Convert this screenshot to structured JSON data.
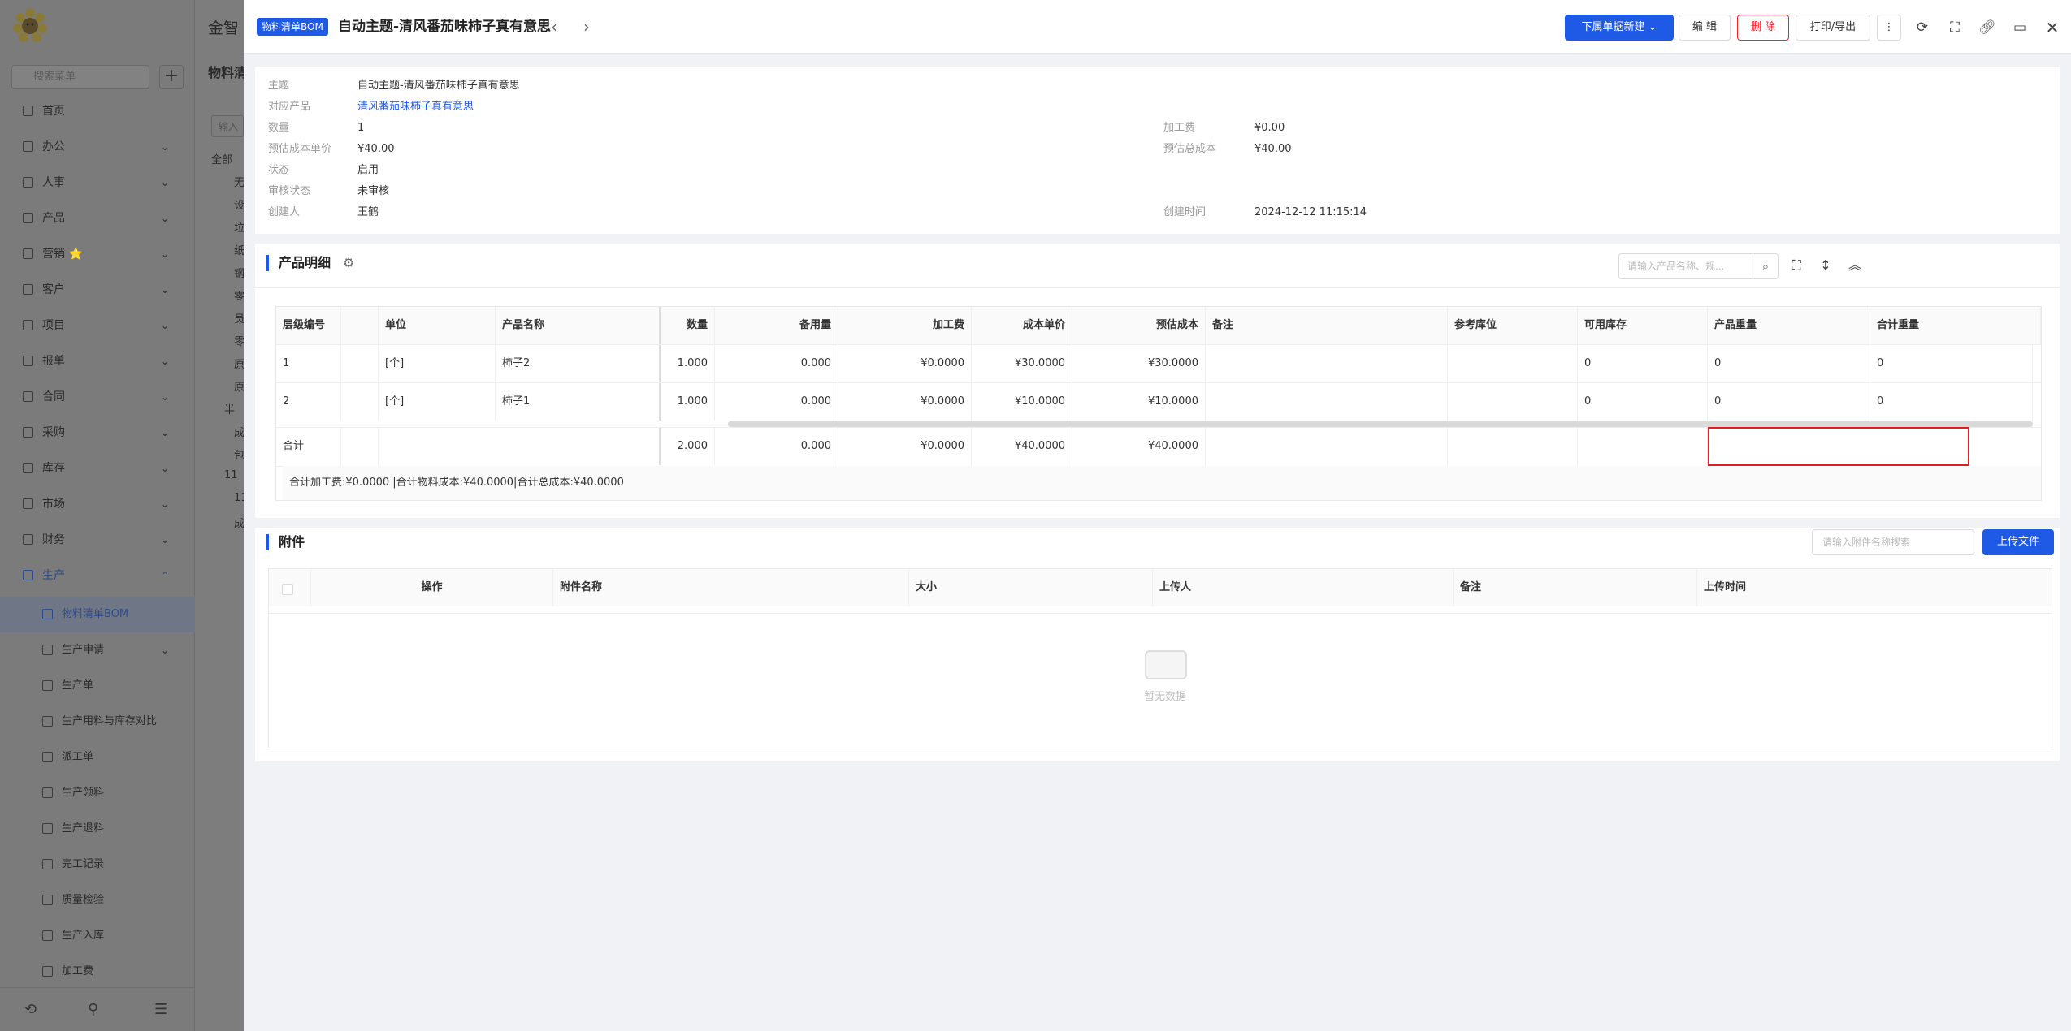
{
  "app": {
    "title": "金智"
  },
  "sidebar": {
    "search_placeholder": "搜索菜单",
    "add_label": "+",
    "items": [
      {
        "label": "首页"
      },
      {
        "label": "办公"
      },
      {
        "label": "人事"
      },
      {
        "label": "产品"
      },
      {
        "label": "营销 ⭐"
      },
      {
        "label": "客户"
      },
      {
        "label": "项目"
      },
      {
        "label": "报单"
      },
      {
        "label": "合同"
      },
      {
        "label": "采购"
      },
      {
        "label": "库存"
      },
      {
        "label": "市场"
      },
      {
        "label": "财务"
      },
      {
        "label": "生产"
      }
    ],
    "sub_items": [
      {
        "label": "物料清单BOM"
      },
      {
        "label": "生产申请"
      },
      {
        "label": "生产单"
      },
      {
        "label": "生产用料与库存对比"
      },
      {
        "label": "派工单"
      },
      {
        "label": "生产领料"
      },
      {
        "label": "生产退料"
      },
      {
        "label": "完工记录"
      },
      {
        "label": "质量检验"
      },
      {
        "label": "生产入库"
      },
      {
        "label": "加工费"
      }
    ]
  },
  "behind": {
    "title": "物料清",
    "tree": [
      "全部",
      "无",
      "设",
      "垃",
      "纸",
      "钢",
      "零",
      "员",
      "零",
      "原",
      "原",
      "半",
      "成",
      "包",
      "11",
      "11",
      "成"
    ],
    "input_placeholder": "输入"
  },
  "header": {
    "tag": "物料清单BOM",
    "title": "自动主题-清风番茄味柿子真有意思",
    "prev": "‹",
    "next": "›",
    "buttons": {
      "new": "下属单据新建",
      "edit": "编 辑",
      "delete": "删 除",
      "print": "打印/导出",
      "more": "⋮"
    }
  },
  "info": {
    "subject_label": "主题",
    "subject": "自动主题-清风番茄味柿子真有意思",
    "product_label": "对应产品",
    "product": "清风番茄味柿子真有意思",
    "qty_label": "数量",
    "qty": "1",
    "unit_cost_label": "预估成本单价",
    "unit_cost": "¥40.00",
    "status_label": "状态",
    "status": "启用",
    "audit_label": "审核状态",
    "audit": "未审核",
    "creator_label": "创建人",
    "creator": "王鹤",
    "process_fee_label": "加工费",
    "process_fee": "¥0.00",
    "total_cost_label": "预估总成本",
    "total_cost": "¥40.00",
    "created_label": "创建时间",
    "created": "2024-12-12 11:15:14"
  },
  "detail": {
    "title": "产品明细",
    "search_placeholder": "请输入产品名称、规...",
    "columns": [
      "层级编号",
      "单位",
      "产品名称",
      "数量",
      "备用量",
      "加工费",
      "成本单价",
      "预估成本",
      "备注",
      "参考库位",
      "可用库存",
      "产品重量",
      "合计重量"
    ],
    "rows": [
      {
        "level": "1",
        "unit": "[个]",
        "name": "柿子2",
        "qty": "1.000",
        "spare": "0.000",
        "fee": "¥0.0000",
        "unit_cost": "¥30.0000",
        "cost": "¥30.0000",
        "stock": "0",
        "weight": "0",
        "total_weight": "0"
      },
      {
        "level": "2",
        "unit": "[个]",
        "name": "柿子1",
        "qty": "1.000",
        "spare": "0.000",
        "fee": "¥0.0000",
        "unit_cost": "¥10.0000",
        "cost": "¥10.0000",
        "stock": "0",
        "weight": "0",
        "total_weight": "0"
      }
    ],
    "total": {
      "label": "合计",
      "qty": "2.000",
      "spare": "0.000",
      "fee": "¥0.0000",
      "unit_cost": "¥40.0000",
      "cost": "¥40.0000"
    },
    "summary": "合计加工费:¥0.0000 |合计物料成本:¥40.0000|合计总成本:¥40.0000"
  },
  "attach": {
    "title": "附件",
    "search_placeholder": "请输入附件名称搜索",
    "upload": "上传文件",
    "columns": [
      "操作",
      "附件名称",
      "大小",
      "上传人",
      "备注",
      "上传时间"
    ],
    "empty": "暂无数据"
  },
  "colors": {
    "primary": "#1f5ae6",
    "danger": "#f5222d",
    "highlight": "#e02020"
  }
}
